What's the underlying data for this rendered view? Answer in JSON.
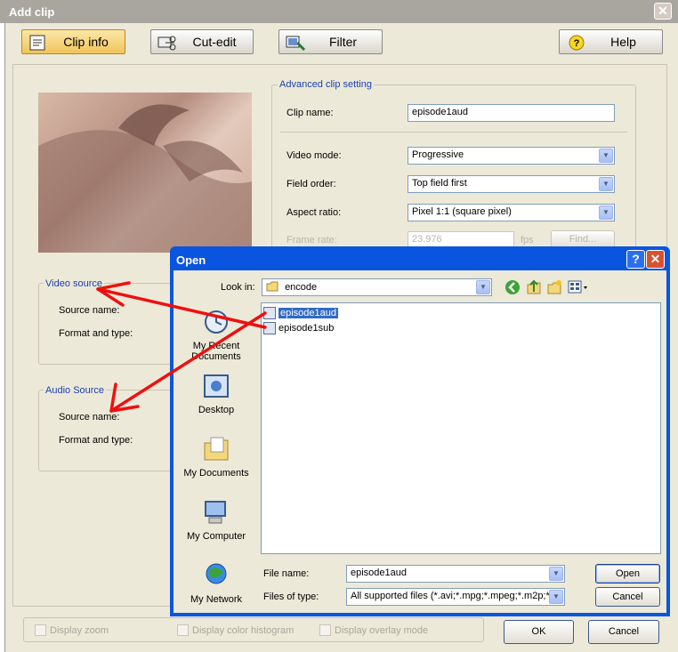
{
  "window": {
    "title": "Add clip",
    "close_glyph": "✕"
  },
  "toolbar": {
    "clip_info": "Clip info",
    "cut_edit": "Cut-edit",
    "filter": "Filter",
    "help": "Help"
  },
  "advanced": {
    "group_title": "Advanced clip setting",
    "clip_name_label": "Clip name:",
    "clip_name_value": "episode1aud",
    "video_mode_label": "Video mode:",
    "video_mode_value": "Progressive",
    "field_order_label": "Field order:",
    "field_order_value": "Top field first",
    "aspect_ratio_label": "Aspect ratio:",
    "aspect_ratio_value": "Pixel 1:1 (square pixel)",
    "frame_rate_label": "Frame rate:",
    "frame_rate_value": "23.976",
    "fps_label": "fps",
    "find_button": "Find..."
  },
  "video_source": {
    "group_title": "Video source",
    "source_name_label": "Source name:",
    "format_label": "Format and type:"
  },
  "audio_source": {
    "group_title": "Audio Source",
    "source_name_label": "Source name:",
    "format_label": "Format and type:"
  },
  "bottom": {
    "display_zoom": "Display zoom",
    "display_color_histogram": "Display color histogram",
    "display_overlay_mode": "Display overlay mode",
    "ok": "OK",
    "cancel": "Cancel"
  },
  "open_dialog": {
    "title": "Open",
    "help_glyph": "?",
    "close_glyph": "✕",
    "look_in_label": "Look in:",
    "look_in_value": "encode",
    "places": [
      "My Recent Documents",
      "Desktop",
      "My Documents",
      "My Computer",
      "My Network"
    ],
    "files": [
      "episode1aud",
      "episode1sub"
    ],
    "selected_file": "episode1aud",
    "file_name_label": "File name:",
    "file_name_value": "episode1aud",
    "files_of_type_label": "Files of type:",
    "files_of_type_value": "All supported files (*.avi;*.mpg;*.mpeg;*.m2p;*.m",
    "open_button": "Open",
    "cancel_button": "Cancel"
  },
  "colors": {
    "dialog_blue": "#0a55e0",
    "group_title_blue": "#1c3fae",
    "selection_blue": "#316ac5",
    "annotation_red": "#ee1010"
  }
}
